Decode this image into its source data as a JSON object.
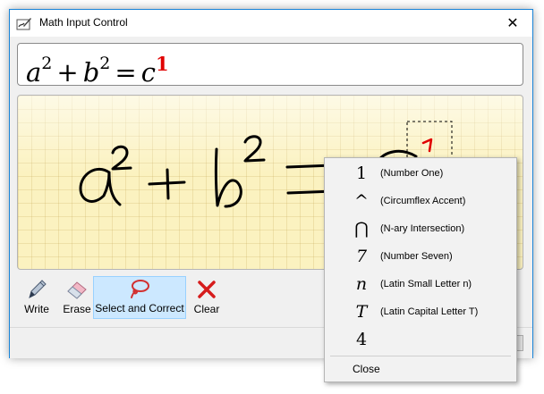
{
  "window": {
    "title": "Math Input Control",
    "close_glyph": "✕"
  },
  "preview": {
    "a": "a",
    "exp_a": "2",
    "plus": "+",
    "b": "b",
    "exp_b": "2",
    "equals": "=",
    "c": "c",
    "c_marker": "1"
  },
  "toolbar": {
    "write_label": "Write",
    "erase_label": "Erase",
    "select_correct_label": "Select and Correct",
    "clear_label": "Clear"
  },
  "correction_menu": {
    "items": [
      {
        "glyph": "1",
        "label": "(Number One)"
      },
      {
        "glyph": "^",
        "label": "(Circumflex Accent)"
      },
      {
        "glyph": "⋂",
        "label": "(N-ary Intersection)"
      },
      {
        "glyph": "7",
        "label": "(Number Seven)"
      },
      {
        "glyph": "n",
        "label": "(Latin Small Letter n)"
      },
      {
        "glyph": "T",
        "label": "(Latin Capital Letter T)"
      },
      {
        "glyph": "4",
        "label": ""
      }
    ],
    "close_label": "Close"
  },
  "colors": {
    "accent_border": "#1883d7",
    "ink": "#000000",
    "correction_red": "#e00000",
    "writing_pad": "#fbf2c0",
    "selected_tool": "#cce8ff"
  },
  "icons": {
    "app": "pen-ink-icon",
    "write": "pen-icon",
    "erase": "eraser-icon",
    "select_correct": "lasso-icon",
    "clear": "red-x-icon"
  }
}
